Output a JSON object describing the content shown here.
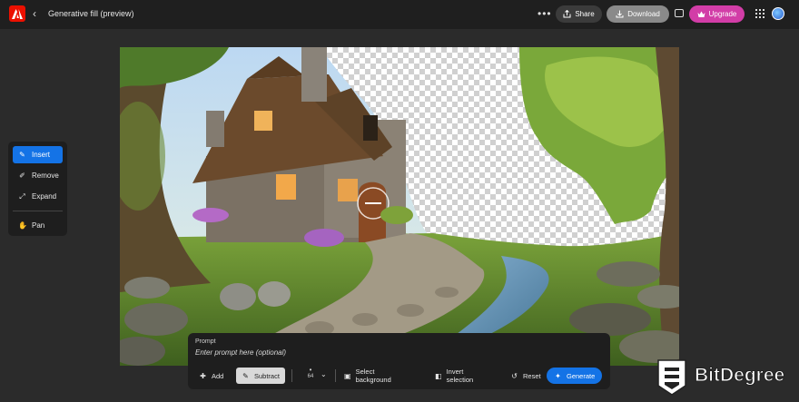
{
  "header": {
    "logo_icon": "adobe-logo",
    "back_icon": "chevron-left-icon",
    "title": "Generative fill (preview)",
    "more_icon": "more-horizontal-icon",
    "share_label": "Share",
    "download_label": "Download",
    "upgrade_label": "Upgrade",
    "chat_icon": "comment-icon",
    "apps_icon": "app-grid-icon"
  },
  "tools": {
    "items": [
      {
        "label": "Insert",
        "icon": "insert-brush-icon",
        "active": true
      },
      {
        "label": "Remove",
        "icon": "remove-brush-icon",
        "active": false
      },
      {
        "label": "Expand",
        "icon": "expand-icon",
        "active": false
      },
      {
        "label": "Pan",
        "icon": "hand-icon",
        "active": false
      }
    ]
  },
  "prompt": {
    "label": "Prompt",
    "placeholder": "Enter prompt here (optional)",
    "add_label": "Add",
    "subtract_label": "Subtract",
    "brush_size": "64",
    "select_background_label": "Select background",
    "invert_selection_label": "Invert selection",
    "reset_label": "Reset",
    "generate_label": "Generate"
  },
  "watermark": {
    "text": "BitDegree"
  },
  "colors": {
    "accent": "#1473e6",
    "upgrade": "#d23da7",
    "logo": "#eb1000"
  }
}
